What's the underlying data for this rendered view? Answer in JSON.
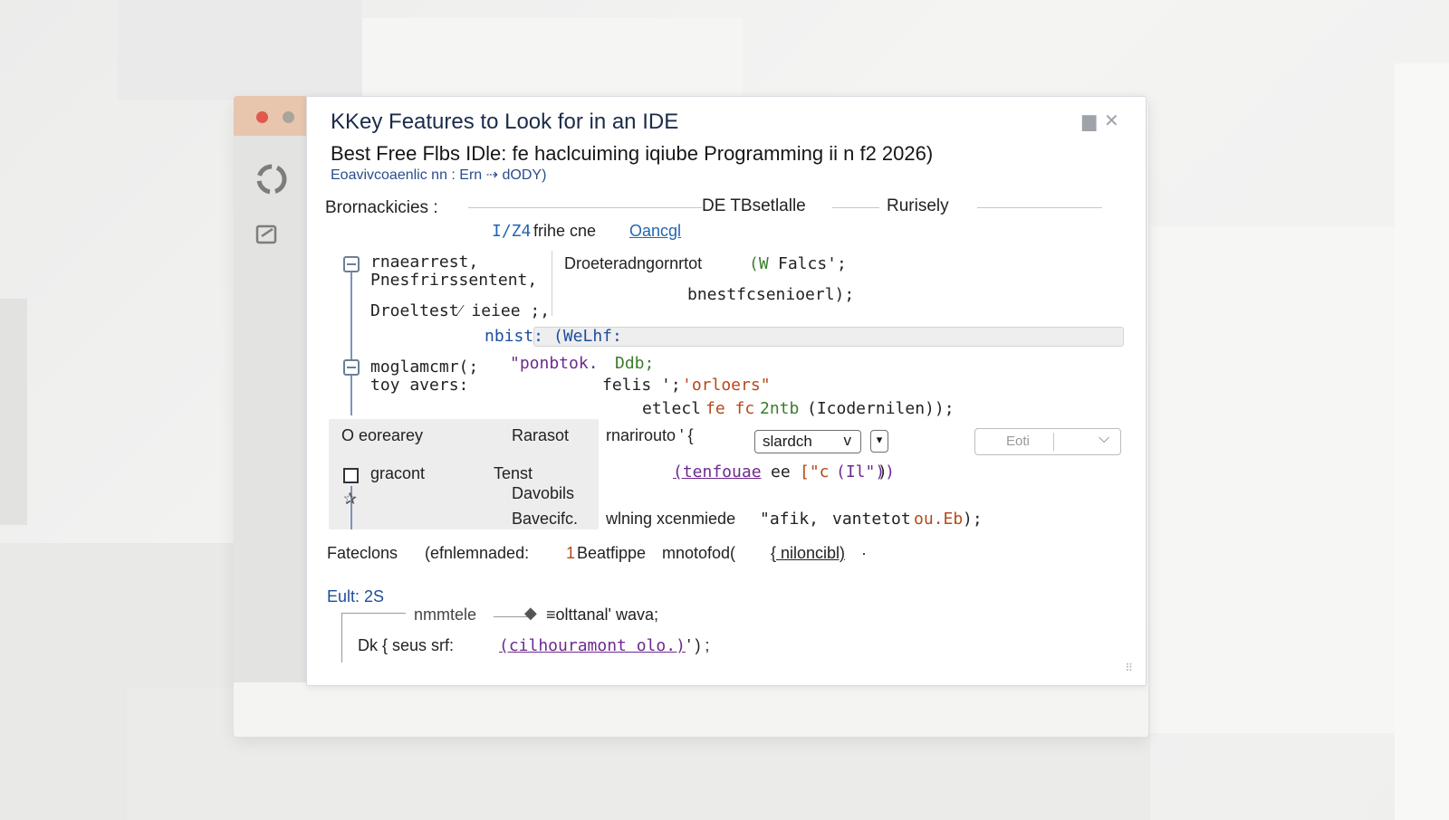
{
  "window": {
    "title": "KKey Features to Look for in an IDE",
    "subtitle": "Best Free Flbs IDle: fe haclcuiming iqiube Programming ii n  f2 2026)",
    "subline": "Eoavivcoaenlic nn : Ern ⇢ dODY)",
    "close_icon_char": "✕",
    "restore_icon_char": "▆"
  },
  "section_header": {
    "label": "Brornackicies  :",
    "col2": "DE TBsetlalle",
    "col3": "Rurisely"
  },
  "toolbar_line": {
    "prefix": "I/Z4",
    "text": "frihe cne",
    "link": "Oancgl"
  },
  "code": {
    "l1a": "rnaearrest,",
    "l1b": "Pnesfrirssentent,",
    "l1c": "Droeltest⁄ ieiee ;,",
    "r1a": "Droeteradngornrtot",
    "r1b": "(W",
    "r1c": "Falcs';",
    "r2": "bnestfcsenioerl);",
    "hl_key": "nbist:",
    "hl_val": "(WeLhf:",
    "l2a": "moglamcmr(;",
    "l2b": "toy avers:",
    "s1": "\"ponbtok.",
    "s1b": "Ddb;",
    "s2a": "felis ';",
    "s2b": "'orloers\"",
    "s3a": "etlecl",
    "s3b": "fe fc",
    "s3c": "2ntb",
    "s3d": "(Icodernilen));",
    "p1": "rnarirouto  ' {",
    "p2a": "(tenfouae",
    "p2b": "ee",
    "p2c": "[\"c",
    "p2d": "(Il\"))",
    "p2e": ")",
    "w1": "wlning xcenmiede",
    "w2": "\"afik,",
    "w3": "vantetot",
    "w4": "ou.Eb",
    "w5": ");"
  },
  "grey_block": {
    "r1_left": "O eorearey",
    "r1_right": "Rarasot",
    "r2_left": "gracont",
    "r2_right": "Tenst",
    "r3_right": "Davobils",
    "r4_right": "Bavecifc."
  },
  "controls": {
    "select_value": "slardch",
    "select_chevron": "v",
    "mini_btn": "▾",
    "dropdown_value": "Eoti",
    "dropdown_chevron": "⌵"
  },
  "features_line": {
    "label": "Fateclons",
    "arg1": "(efnlemnaded:",
    "num": "1",
    "arg2": "Beatfippe",
    "arg3": "mnotofod(",
    "arg4": "{ niloncibl)",
    "tail": "·"
  },
  "bottom": {
    "label": "Eult: 2S",
    "l1a": "nmmtele",
    "l1b": "≡olttanal' wava;",
    "l2a": "Dk { seus srf:",
    "l2b": "(cilhouramont olo.)",
    "l2c": "' ) ;"
  },
  "colors": {
    "accent": "#2366b4",
    "title": "#1b2c4a",
    "green": "#3b7d2c",
    "purple": "#6d2a8f",
    "orange": "#b5491b"
  }
}
